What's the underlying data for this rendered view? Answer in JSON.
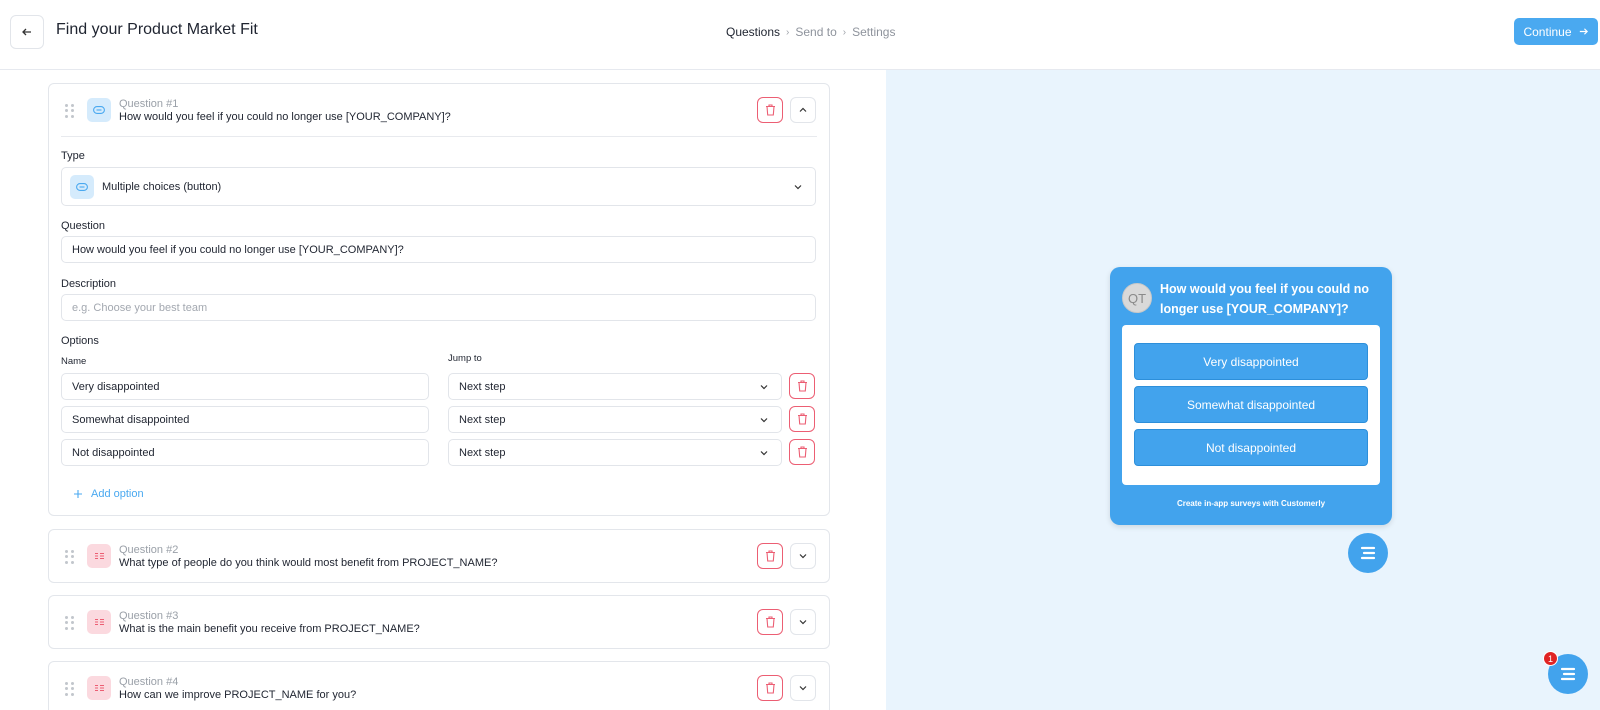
{
  "header": {
    "title": "Find your Product Market Fit",
    "steps": [
      "Questions",
      "Send to",
      "Settings"
    ],
    "continue_label": "Continue"
  },
  "questions": [
    {
      "number_label": "Question #1",
      "text": "How would you feel if you could no longer use [YOUR_COMPANY]?",
      "icon": "link-icon",
      "expanded": true,
      "type_label": "Type",
      "type_value": "Multiple choices (button)",
      "question_label": "Question",
      "question_value": "How would you feel if you could no longer use [YOUR_COMPANY]?",
      "description_label": "Description",
      "description_placeholder": "e.g. Choose your best team",
      "options_label": "Options",
      "name_col": "Name",
      "jump_col": "Jump to",
      "options": [
        {
          "name": "Very disappointed",
          "jump": "Next step"
        },
        {
          "name": "Somewhat disappointed",
          "jump": "Next step"
        },
        {
          "name": "Not disappointed",
          "jump": "Next step"
        }
      ],
      "add_option_label": "Add option"
    },
    {
      "number_label": "Question #2",
      "text": "What type of people do you think would most benefit from PROJECT_NAME?",
      "icon": "list-icon",
      "expanded": false
    },
    {
      "number_label": "Question #3",
      "text": "What is the main benefit you receive from PROJECT_NAME?",
      "icon": "list-icon",
      "expanded": false
    },
    {
      "number_label": "Question #4",
      "text": "How can we improve PROJECT_NAME for you?",
      "icon": "list-icon",
      "expanded": false
    }
  ],
  "preview": {
    "avatar_initials": "QT",
    "question": "How would you feel if you could no longer use [YOUR_COMPANY]?",
    "options": [
      "Very disappointed",
      "Somewhat disappointed",
      "Not disappointed"
    ],
    "footer": "Create in-app surveys with Customerly"
  },
  "chat": {
    "badge_count": "1"
  },
  "colors": {
    "accent": "#42a3ed",
    "danger": "#ec5e73",
    "preview_bg": "#e9f4fd"
  }
}
